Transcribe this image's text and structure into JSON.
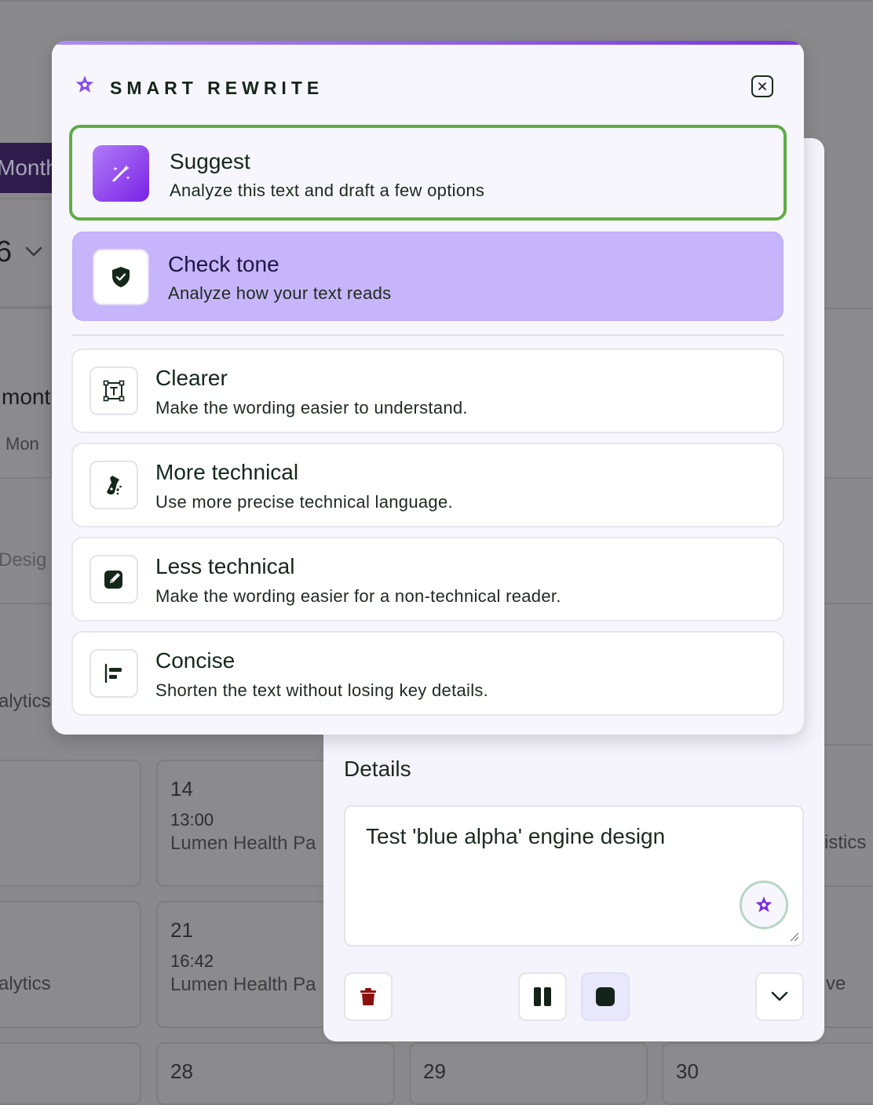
{
  "background": {
    "month_label": "Month",
    "year_fragment": "6",
    "month_fragment": "mont",
    "weekday_fragment": "Mon",
    "design_fragment": "Desig",
    "analytics_fragment": "alytics",
    "analytics_fragment_2": "alytics",
    "istics_fragment": "istics",
    "ve_fragment": "ve",
    "day_14": "14",
    "time_14": "13:00",
    "event_14": "Lumen Health Pa",
    "day_21": "21",
    "time_21": "16:42",
    "event_21": "Lumen Health Pa",
    "day_28": "28",
    "day_29": "29",
    "day_30": "30"
  },
  "popover": {
    "title": "SMART REWRITE",
    "accent_color": "#7b35e2",
    "options": [
      {
        "title": "Suggest",
        "desc": "Analyze this text and draft a few options",
        "icon": "magic-wand-icon"
      },
      {
        "title": "Check tone",
        "desc": "Analyze how your text reads",
        "icon": "shield-check-icon"
      },
      {
        "title": "Clearer",
        "desc": "Make the wording easier to understand.",
        "icon": "text-frame-icon"
      },
      {
        "title": "More technical",
        "desc": "Use more precise technical language.",
        "icon": "flask-icon"
      },
      {
        "title": "Less technical",
        "desc": "Make the wording easier for a non-technical reader.",
        "icon": "edit-square-icon"
      },
      {
        "title": "Concise",
        "desc": "Shorten the text without losing key details.",
        "icon": "align-left-icon"
      }
    ]
  },
  "details": {
    "label": "Details",
    "value": "Test 'blue alpha' engine design"
  },
  "colors": {
    "suggest_border": "#5fac45",
    "tone_bg": "#c7b5fb",
    "delete_red": "#8b0f0f"
  }
}
